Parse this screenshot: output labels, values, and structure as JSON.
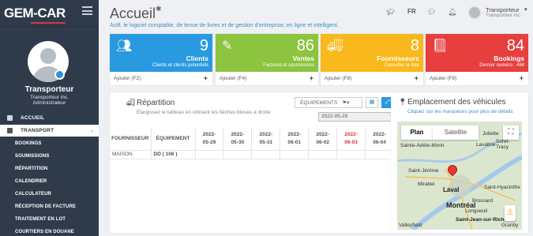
{
  "sidebar": {
    "logo": "GEM-CAR",
    "user_name": "Transporteur",
    "user_company": "Transporteur inc.",
    "user_role": "Administrateur",
    "menu": [
      {
        "label": "ACCUEIL",
        "active": false
      },
      {
        "label": "TRANSPORT",
        "active": true
      }
    ],
    "submenu": [
      "BOOKINGS",
      "SOUMISSIONS",
      "RÉPARTITION",
      "CALENDRIER",
      "CALCULATEUR",
      "RÉCEPTION DE FACTURE",
      "TRAITEMENT EN LOT",
      "COURTIERS EN DOUANE"
    ]
  },
  "header": {
    "title": "Accueil",
    "subtitle": "Actif, le logiciel comptable, de tenue de livres et de gestion d'entreprise, en ligne et intelligent.",
    "language": "FR",
    "user_name": "Transporteur",
    "user_company": "Transporteur inc."
  },
  "cards": [
    {
      "count": "9",
      "label": "Clients",
      "sub": "Clients et clients potentiels",
      "add": "Ajouter (F2)",
      "color": "#2a9ae0",
      "icon": "users-icon"
    },
    {
      "count": "86",
      "label": "Ventes",
      "sub": "Factures et soumissions",
      "add": "Ajouter (F4)",
      "color": "#8cc43f",
      "icon": "edit-icon"
    },
    {
      "count": "8",
      "label": "Fournisseurs",
      "sub": "Consulter la liste",
      "add": "Ajouter (F8)",
      "color": "#f9b81b",
      "icon": "truck-icon"
    },
    {
      "count": "84",
      "label": "Bookings",
      "sub": "Dernier numéro : #84",
      "add": "Ajouter (F9)",
      "color": "#e73e3e",
      "icon": "book-icon"
    }
  ],
  "repartition": {
    "title": "Répartition",
    "description": "Élargissez le tableau en utilisant les flèches bleues à droite",
    "equipment_button": "ÉQUIPEMENTS",
    "date": "2022-05-29",
    "columns": {
      "supplier": "FOURNISSEUR",
      "equipment": "ÉQUIPEMENT"
    },
    "dates": [
      {
        "y": "2022-",
        "d": "05-29",
        "red": false
      },
      {
        "y": "2022-",
        "d": "05-30",
        "red": false
      },
      {
        "y": "2022-",
        "d": "05-31",
        "red": false
      },
      {
        "y": "2022-",
        "d": "06-01",
        "red": false
      },
      {
        "y": "2022-",
        "d": "06-02",
        "red": false
      },
      {
        "y": "2022-",
        "d": "06-03",
        "red": true
      },
      {
        "y": "2022-",
        "d": "06-04",
        "red": false
      }
    ],
    "rows": [
      {
        "supplier": "MAISON",
        "equipment": "DD ( 106 )"
      }
    ]
  },
  "vehicles": {
    "title": "Emplacement des véhicules",
    "description": "Cliquez sur les marqueurs pour plus de détails",
    "map_tabs": [
      "Plan",
      "Satellite"
    ],
    "places": [
      "Joliette",
      "Lavaltrie",
      "Sorel-Tracy",
      "Saint-Jérôme",
      "Mirabel",
      "Laval",
      "Montréal",
      "Saint-Hyacinthe",
      "Longueuil",
      "Saint-Jean-sur-Richelieu",
      "Valleyfield",
      "Granby",
      "Sainte-Adèle-Morin",
      "Brossard"
    ]
  }
}
